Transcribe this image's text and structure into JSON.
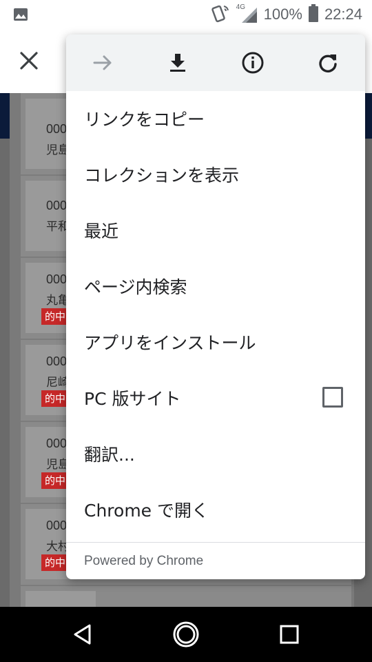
{
  "status_bar": {
    "network": "4G",
    "battery": "100%",
    "time": "22:24"
  },
  "page_list": [
    {
      "code": "000",
      "name": "児島",
      "hit": ""
    },
    {
      "code": "000",
      "name": "平和",
      "hit": ""
    },
    {
      "code": "000",
      "name": "丸亀",
      "hit": "的中"
    },
    {
      "code": "000",
      "name": "尼崎",
      "hit": "的中"
    },
    {
      "code": "000",
      "name": "児島",
      "hit": "的中"
    },
    {
      "code": "000",
      "name": "大村",
      "hit": "的中"
    }
  ],
  "menu": {
    "items": [
      {
        "label": "リンクをコピー"
      },
      {
        "label": "コレクションを表示"
      },
      {
        "label": "最近"
      },
      {
        "label": "ページ内検索"
      },
      {
        "label": "アプリをインストール"
      },
      {
        "label": "PC 版サイト",
        "checked": false
      },
      {
        "label": "翻訳..."
      },
      {
        "label": "Chrome で開く"
      }
    ],
    "footer": "Powered by Chrome"
  },
  "icons": {
    "close": "close-icon",
    "forward": "arrow-forward-icon",
    "download": "download-icon",
    "info": "info-icon",
    "reload": "reload-icon"
  },
  "colors": {
    "menu_bg": "#ffffff",
    "menu_iconbar_bg": "#f1f3f4",
    "hit_badge": "#c62828"
  }
}
